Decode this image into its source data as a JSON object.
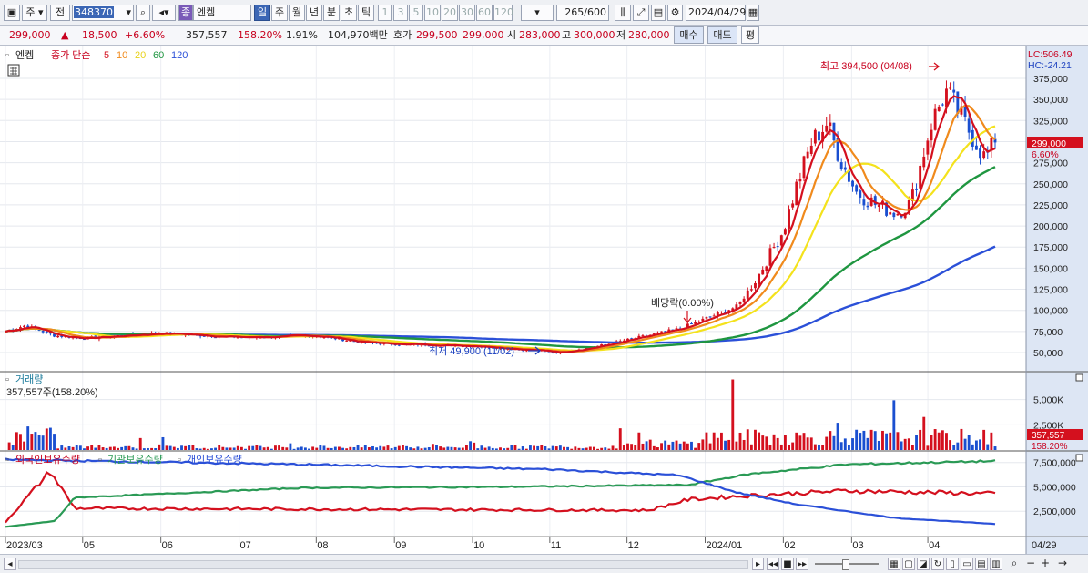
{
  "toolbar": {
    "market_label": "주",
    "prev_label": "전",
    "code_value": "348370",
    "name_type_label": "종",
    "stock_name": "엔켐",
    "periods": [
      "일",
      "주",
      "월",
      "년",
      "분",
      "초",
      "틱"
    ],
    "active_period": "일",
    "intervals": [
      "1",
      "3",
      "5",
      "10",
      "20",
      "30",
      "60",
      "120"
    ],
    "count_value": "265",
    "count_max": "/600",
    "date_value": "2024/04/29"
  },
  "quote": {
    "price": "299,000",
    "change_arrow": "▲",
    "change": "18,500",
    "change_pct": "+6.60%",
    "volume": "357,557",
    "volume_ratio": "158.20%",
    "turnover_rate": "1.91%",
    "trade_amount": "104,970백만",
    "bid_ask_label": "호가",
    "ask": "299,500",
    "bid": "299,000",
    "open_label": "시",
    "open": "283,000",
    "high_label": "고",
    "high": "300,000",
    "low_label": "저",
    "low": "280,000",
    "buy_label": "매수",
    "sell_label": "매도",
    "eval_label": "평"
  },
  "price_panel": {
    "stock_label": "엔켐",
    "ma_title": "종가 단순",
    "ma_periods": [
      "5",
      "10",
      "20",
      "60",
      "120"
    ],
    "lc": "LC:506.49",
    "hc": "HC:-24.21",
    "high_annotation": "최고 394,500 (04/08)",
    "low_annotation": "최저 49,900 (11/02)",
    "dividend_annotation": "배당락(0.00%)",
    "current_price_tag": "299,000",
    "current_pct_tag": "6.60%",
    "y_labels": [
      "375,000",
      "350,000",
      "325,000",
      "300,000",
      "275,000",
      "250,000",
      "225,000",
      "200,000",
      "175,000",
      "150,000",
      "125,000",
      "100,000",
      "75,000",
      "50,000"
    ]
  },
  "volume_panel": {
    "title": "거래량",
    "summary": "357,557주(158.20%)",
    "y_labels": [
      "5,000K",
      "2,500K"
    ],
    "current_tag": "357,557",
    "current_pct_tag": "158.20%"
  },
  "holdings_panel": {
    "legend": [
      "외국인보유수량",
      "기관보유수량",
      "개인보유수량"
    ],
    "y_labels": [
      "7,500,000",
      "5,000,000",
      "2,500,000"
    ]
  },
  "x_axis": {
    "labels": [
      "2023/03",
      "05",
      "06",
      "07",
      "08",
      "09",
      "10",
      "11",
      "12",
      "2024/01",
      "02",
      "03",
      "04"
    ],
    "end_label": "04/29"
  },
  "colors": {
    "ma5": "#d4101e",
    "ma10": "#f08a1c",
    "ma20": "#f4e21c",
    "ma60": "#1f9640",
    "ma120": "#2b50d8",
    "up": "#d4101e",
    "down": "#1a4fd0",
    "foreign": "#d4101e",
    "institution": "#2a9a55",
    "individual": "#2b50d8"
  },
  "chart_data": [
    {
      "type": "candlestick",
      "title": "엔켐 종가 단순 5 10 20 60 120",
      "ylim": [
        25000,
        400000
      ],
      "x_range": [
        "2023/03",
        "2024/04/29"
      ],
      "price_anchors": [
        {
          "date": "2023/03",
          "close": 75000
        },
        {
          "date": "2023/05",
          "close": 68000
        },
        {
          "date": "2023/06",
          "close": 73000
        },
        {
          "date": "2023/07",
          "close": 68000
        },
        {
          "date": "2023/08",
          "close": 70000
        },
        {
          "date": "2023/09",
          "close": 60000
        },
        {
          "date": "2023/10",
          "close": 58000
        },
        {
          "date": "2023/11/02",
          "close": 49900
        },
        {
          "date": "2023/12",
          "close": 65000
        },
        {
          "date": "2024/01",
          "close": 92000
        },
        {
          "date": "2024/01/20",
          "close": 140000
        },
        {
          "date": "2024/02",
          "close": 200000
        },
        {
          "date": "2024/02/20",
          "close": 320000
        },
        {
          "date": "2024/03",
          "close": 255000
        },
        {
          "date": "2024/03/25",
          "close": 218000
        },
        {
          "date": "2024/04/08",
          "close": 394500
        },
        {
          "date": "2024/04/29",
          "close": 299000
        }
      ],
      "moving_averages": [
        "5",
        "10",
        "20",
        "60",
        "120"
      ]
    },
    {
      "type": "bar",
      "title": "거래량",
      "ylim": [
        0,
        7500000
      ],
      "latest": 357557
    },
    {
      "type": "line",
      "series": [
        {
          "name": "외국인보유수량",
          "anchors": [
            [
              0,
              1400000
            ],
            [
              0.045,
              6600000
            ],
            [
              0.07,
              2800000
            ],
            [
              0.65,
              2600000
            ],
            [
              0.69,
              3700000
            ],
            [
              0.75,
              4100000
            ],
            [
              0.85,
              4600000
            ],
            [
              1,
              4300000
            ]
          ]
        },
        {
          "name": "기관보유수량",
          "anchors": [
            [
              0,
              900000
            ],
            [
              0.05,
              1500000
            ],
            [
              0.07,
              3900000
            ],
            [
              0.3,
              4900000
            ],
            [
              0.5,
              5000000
            ],
            [
              0.69,
              5200000
            ],
            [
              0.75,
              6300000
            ],
            [
              0.85,
              7300000
            ],
            [
              1,
              7650000
            ]
          ]
        },
        {
          "name": "개인보유수량",
          "anchors": [
            [
              0,
              7800000
            ],
            [
              0.3,
              7300000
            ],
            [
              0.55,
              6800000
            ],
            [
              0.68,
              6200000
            ],
            [
              0.74,
              4400000
            ],
            [
              0.8,
              3200000
            ],
            [
              0.9,
              1800000
            ],
            [
              1,
              1200000
            ]
          ]
        }
      ],
      "ylim": [
        0,
        8500000
      ]
    }
  ]
}
